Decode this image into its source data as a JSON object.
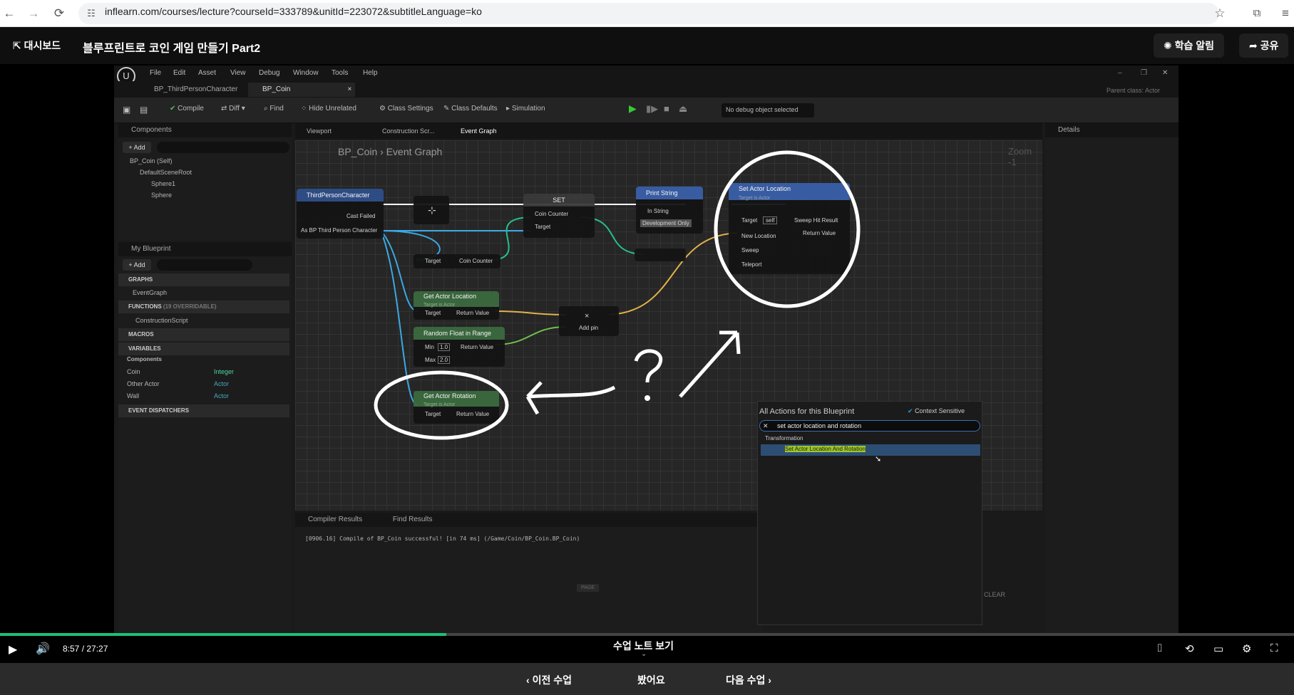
{
  "browser": {
    "url": "inflearn.com/courses/lecture?courseId=333789&unitId=223072&subtitleLanguage=ko"
  },
  "header": {
    "dashboard_label": "대시보드",
    "course_title": "블루프린트로 코인 게임 만들기 Part2",
    "alarm_label": "학습 알림",
    "share_label": "공유"
  },
  "ue": {
    "menu": [
      "File",
      "Edit",
      "Asset",
      "View",
      "Debug",
      "Window",
      "Tools",
      "Help"
    ],
    "tabs": [
      "BP_ThirdPersonCharacter",
      "BP_Coin"
    ],
    "parent_class_label": "Parent class:",
    "parent_class_value": "Actor",
    "toolbar": {
      "compile": "Compile",
      "diff": "Diff",
      "find": "Find",
      "hide_unrelated": "Hide Unrelated",
      "class_settings": "Class Settings",
      "class_defaults": "Class Defaults",
      "simulation": "Simulation",
      "debug_select": "No debug object selected"
    },
    "components": {
      "title": "Components",
      "add": "Add",
      "search_placeholder": "Search",
      "items": [
        "BP_Coin (Self)",
        "DefaultSceneRoot",
        "Sphere1",
        "Sphere"
      ]
    },
    "my_blueprint": {
      "title": "My Blueprint",
      "add": "Add",
      "search_placeholder": "Search",
      "graphs": "GRAPHS",
      "event_graph": "EventGraph",
      "functions": "FUNCTIONS",
      "functions_note": "(19 OVERRIDABLE)",
      "construction_script": "ConstructionScript",
      "macros": "MACROS",
      "variables": "VARIABLES",
      "components": "Components",
      "vars": [
        {
          "name": "Coin",
          "type": "Integer"
        },
        {
          "name": "Other Actor",
          "type": "Actor"
        },
        {
          "name": "Wall",
          "type": "Actor"
        }
      ],
      "event_dispatchers": "EVENT DISPATCHERS"
    },
    "graph_tabs": [
      "Viewport",
      "Construction Scr...",
      "Event Graph"
    ],
    "breadcrumb": [
      "BP_Coin",
      "Event Graph"
    ],
    "zoom": "Zoom -1",
    "details_title": "Details",
    "nodes": {
      "cast": {
        "title": "ThirdPersonCharacter",
        "cast_failed": "Cast Failed",
        "as_bp": "As BP Third Person Character"
      },
      "set": {
        "title": "SET",
        "coin_counter": "Coin Counter",
        "target": "Target"
      },
      "get_coin_counter": {
        "target": "Target",
        "value": "Coin Counter"
      },
      "print": {
        "title": "Print String",
        "in_string": "In String",
        "dev_only": "Development Only"
      },
      "set_actor_location": {
        "title": "Set Actor Location",
        "subtitle": "Target is Actor",
        "target": "Target",
        "self": "self",
        "sweep_hit": "Sweep Hit Result",
        "new_location": "New Location",
        "return_value": "Return Value",
        "sweep": "Sweep",
        "teleport": "Teleport"
      },
      "get_actor_location": {
        "title": "Get Actor Location",
        "subtitle": "Target is Actor",
        "target": "Target",
        "return_value": "Return Value"
      },
      "random_float": {
        "title": "Random Float in Range",
        "min": "Min",
        "min_val": "1.0",
        "max": "Max",
        "max_val": "2.0",
        "return_value": "Return Value"
      },
      "multiply": {
        "symbol": "×",
        "add_pin": "Add pin"
      },
      "get_actor_rotation": {
        "title": "Get Actor Rotation",
        "subtitle": "Target is Actor",
        "target": "Target",
        "return_value": "Return Value"
      }
    },
    "actions_menu": {
      "title": "All Actions for this Blueprint",
      "context_sensitive": "Context Sensitive",
      "search_value": "set actor location and rotation",
      "category": "Transformation",
      "result": "Set Actor Location And Rotation"
    },
    "compiler_results": {
      "tab": "Compiler Results",
      "find_results": "Find Results",
      "message": "[0906.16] Compile of BP_Coin successful! [in 74 ms] (/Game/Coin/BP_Coin.BP_Coin)",
      "clear": "CLEAR",
      "page": "PAGE"
    }
  },
  "player": {
    "time": "8:57 / 27:27",
    "progress": 0.345,
    "notes_label": "수업 노트 보기"
  },
  "bottom_nav": {
    "prev": "이전 수업",
    "done": "봤어요",
    "next": "다음 수업"
  }
}
